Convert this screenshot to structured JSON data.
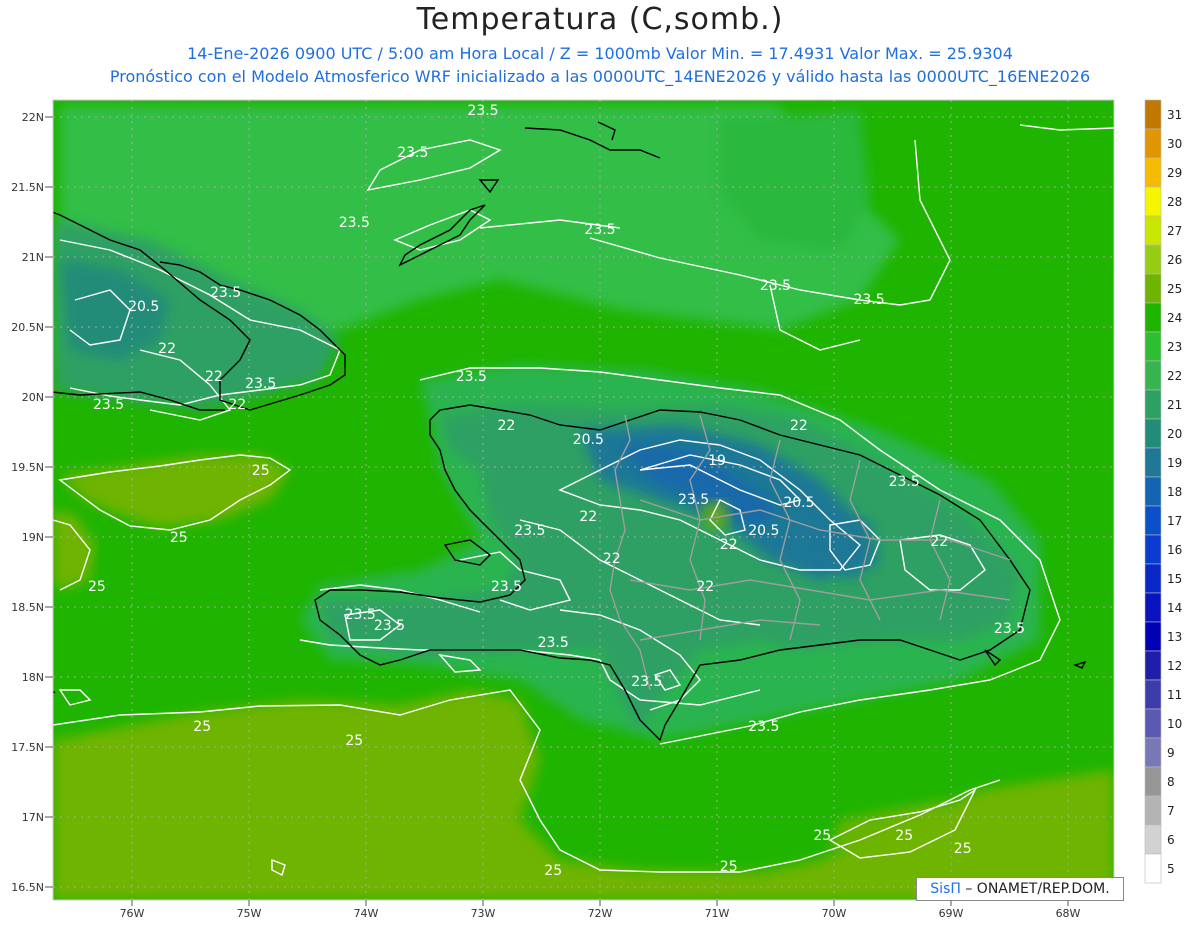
{
  "header": {
    "title": "Temperatura (C,somb.)",
    "line1": "14-Ene-2026  0900 UTC / 5:00 am Hora Local / Z = 1000mb    Valor Min. = 17.4931  Valor Max. = 25.9304",
    "line2": "Pronóstico con el Modelo Atmosferico WRF inicializado a las 0000UTC_14ENE2026 y válido hasta las  0000UTC_16ENE2026"
  },
  "map": {
    "lat_labels": [
      "22N",
      "21.5N",
      "21N",
      "20.5N",
      "20N",
      "19.5N",
      "19N",
      "18.5N",
      "18N",
      "17.5N",
      "17N",
      "16.5N"
    ],
    "lon_labels": [
      "76W",
      "75W",
      "74W",
      "73W",
      "72W",
      "71W",
      "70W",
      "69W",
      "68W"
    ],
    "contour_labels": [
      {
        "text": "23.5",
        "lon": -73.0,
        "lat": 22.05
      },
      {
        "text": "23.5",
        "lon": -73.6,
        "lat": 21.75
      },
      {
        "text": "23.5",
        "lon": -74.1,
        "lat": 21.25
      },
      {
        "text": "23.5",
        "lon": -72.0,
        "lat": 21.2
      },
      {
        "text": "23.5",
        "lon": -70.5,
        "lat": 20.8
      },
      {
        "text": "23.5",
        "lon": -69.7,
        "lat": 20.7
      },
      {
        "text": "20.5",
        "lon": -75.9,
        "lat": 20.65
      },
      {
        "text": "23.5",
        "lon": -75.2,
        "lat": 20.75
      },
      {
        "text": "22",
        "lon": -75.7,
        "lat": 20.35
      },
      {
        "text": "22",
        "lon": -75.3,
        "lat": 20.15
      },
      {
        "text": "23.5",
        "lon": -74.9,
        "lat": 20.1
      },
      {
        "text": "22",
        "lon": -75.1,
        "lat": 19.95
      },
      {
        "text": "23.5",
        "lon": -76.2,
        "lat": 19.95
      },
      {
        "text": "23.5",
        "lon": -73.1,
        "lat": 20.15
      },
      {
        "text": "22",
        "lon": -72.8,
        "lat": 19.8
      },
      {
        "text": "20.5",
        "lon": -72.1,
        "lat": 19.7
      },
      {
        "text": "19",
        "lon": -71.0,
        "lat": 19.55
      },
      {
        "text": "22",
        "lon": -70.3,
        "lat": 19.8
      },
      {
        "text": "23.5",
        "lon": -69.4,
        "lat": 19.4
      },
      {
        "text": "20.5",
        "lon": -70.3,
        "lat": 19.25
      },
      {
        "text": "23.5",
        "lon": -71.2,
        "lat": 19.27
      },
      {
        "text": "22",
        "lon": -72.1,
        "lat": 19.15
      },
      {
        "text": "23.5",
        "lon": -72.6,
        "lat": 19.05
      },
      {
        "text": "20.5",
        "lon": -70.6,
        "lat": 19.05
      },
      {
        "text": "22",
        "lon": -70.9,
        "lat": 18.95
      },
      {
        "text": "22",
        "lon": -69.1,
        "lat": 18.97
      },
      {
        "text": "22",
        "lon": -71.9,
        "lat": 18.85
      },
      {
        "text": "22",
        "lon": -71.1,
        "lat": 18.65
      },
      {
        "text": "23.5",
        "lon": -72.8,
        "lat": 18.65
      },
      {
        "text": "23.5",
        "lon": -74.05,
        "lat": 18.45
      },
      {
        "text": "23.5",
        "lon": -73.8,
        "lat": 18.37
      },
      {
        "text": "23.5",
        "lon": -72.4,
        "lat": 18.25
      },
      {
        "text": "23.5",
        "lon": -71.6,
        "lat": 17.97
      },
      {
        "text": "23.5",
        "lon": -70.6,
        "lat": 17.65
      },
      {
        "text": "23.5",
        "lon": -68.5,
        "lat": 18.35
      },
      {
        "text": "25",
        "lon": -74.9,
        "lat": 19.48
      },
      {
        "text": "25",
        "lon": -75.6,
        "lat": 19.0
      },
      {
        "text": "25",
        "lon": -76.3,
        "lat": 18.65
      },
      {
        "text": "25",
        "lon": -75.4,
        "lat": 17.65
      },
      {
        "text": "25",
        "lon": -74.1,
        "lat": 17.55
      },
      {
        "text": "25",
        "lon": -72.4,
        "lat": 16.62
      },
      {
        "text": "25",
        "lon": -70.9,
        "lat": 16.65
      },
      {
        "text": "25",
        "lon": -70.1,
        "lat": 16.87
      },
      {
        "text": "25",
        "lon": -69.4,
        "lat": 16.87
      },
      {
        "text": "25",
        "lon": -68.9,
        "lat": 16.78
      }
    ]
  },
  "legend": {
    "values": [
      "31",
      "30",
      "29",
      "28",
      "27",
      "26",
      "25",
      "24",
      "23",
      "22",
      "21",
      "20",
      "19",
      "18",
      "17",
      "16",
      "15",
      "14",
      "13",
      "12",
      "11",
      "10",
      "9",
      "8",
      "7",
      "6",
      "5"
    ],
    "colors": [
      "#c07800",
      "#e09600",
      "#f5bb00",
      "#f5f500",
      "#c8e600",
      "#96cd14",
      "#6eb400",
      "#1eb400",
      "#2dbe32",
      "#37b450",
      "#2da064",
      "#238c78",
      "#1e7896",
      "#1464b4",
      "#0a50c8",
      "#0a3cd2",
      "#0a28c8",
      "#0a14be",
      "#0000b4",
      "#1e1eaa",
      "#3c3caa",
      "#5a5ab4",
      "#7878b4",
      "#969696",
      "#b4b4b4",
      "#d2d2d2",
      "#ffffff"
    ]
  },
  "credit": {
    "brand": "SisΠ",
    "text": " – ONAMET/REP.DOM."
  }
}
